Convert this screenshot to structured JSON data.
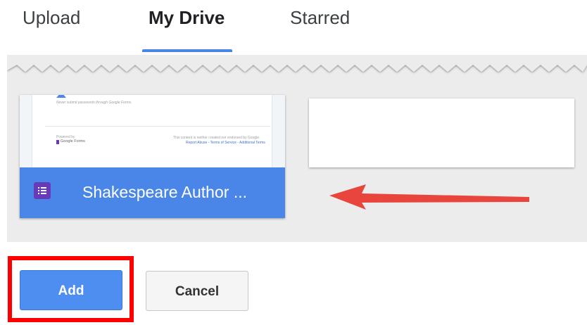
{
  "tabs": [
    {
      "label": "Upload",
      "active": false
    },
    {
      "label": "My Drive",
      "active": true
    },
    {
      "label": "Starred",
      "active": false
    }
  ],
  "file": {
    "name": "Shakespeare Author ...",
    "icon": "google-forms-icon",
    "preview": {
      "line1": "Never submit passwords through Google Forms.",
      "powered_by": "Powered by",
      "brand": "Google Forms",
      "disclaimer": "This content is neither created nor endorsed by Google.",
      "links": "Report Abuse - Terms of Service - Additional Terms"
    }
  },
  "buttons": {
    "add_label": "Add",
    "cancel_label": "Cancel"
  },
  "colors": {
    "accent": "#4a86e8",
    "add_button": "#4d8ef0",
    "forms_icon": "#673ab7",
    "highlight": "#ff0000",
    "arrow": "#e8453c"
  }
}
